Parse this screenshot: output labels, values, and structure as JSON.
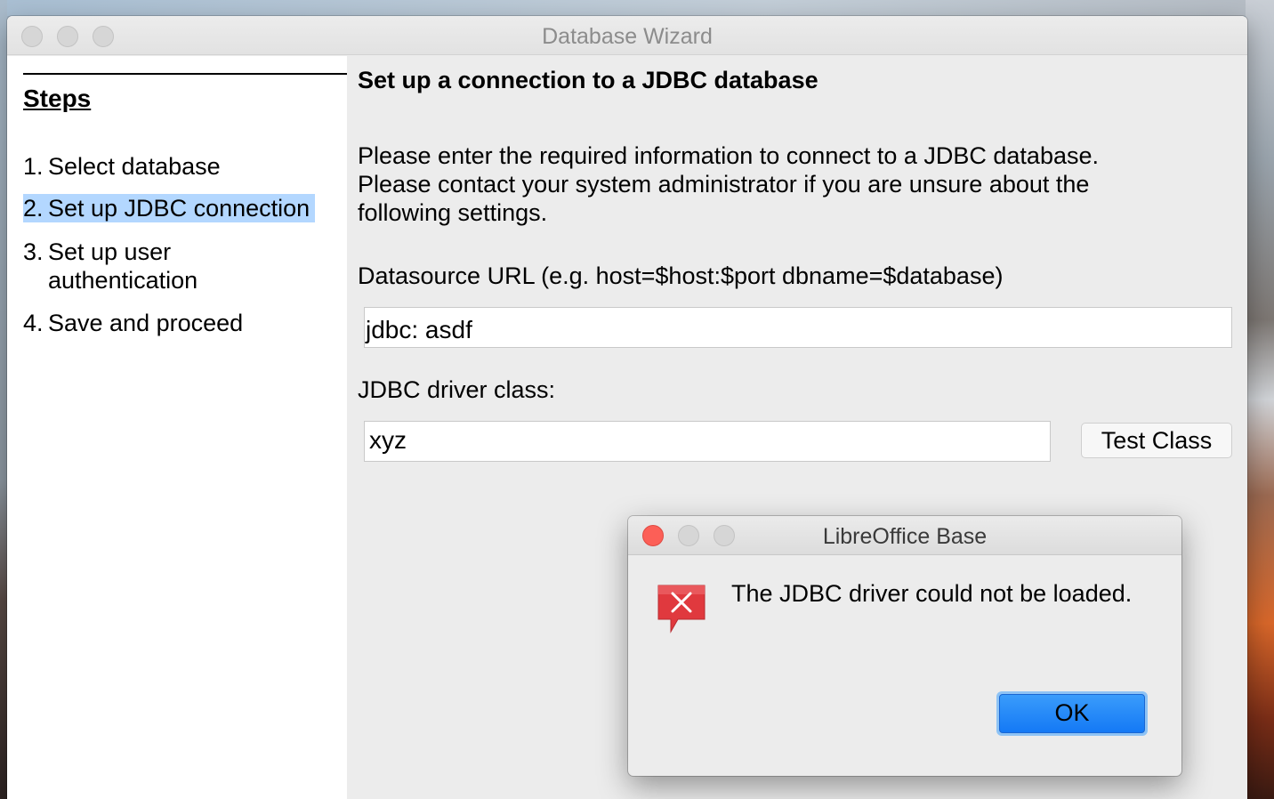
{
  "window": {
    "title": "Database Wizard"
  },
  "sidebar": {
    "heading": "Steps",
    "steps": [
      {
        "number": "1.",
        "label": "Select database",
        "selected": false
      },
      {
        "number": "2.",
        "label": "Set up JDBC connection",
        "selected": true
      },
      {
        "number": "3.",
        "label_line1": "Set up user",
        "label_line2": "authentication",
        "selected": false
      },
      {
        "number": "4.",
        "label": "Save and proceed",
        "selected": false
      }
    ]
  },
  "main": {
    "heading": "Set up a connection to a JDBC database",
    "description_line1": "Please enter the required information to connect to a JDBC database.",
    "description_line2": "Please contact your system administrator if you are unsure about the",
    "description_line3": "following settings.",
    "url_label": "Datasource URL (e.g. host=$host:$port dbname=$database)",
    "url_value": "jdbc: asdf",
    "driver_label": "JDBC driver class:",
    "driver_value": "xyz",
    "test_class_label": "Test Class"
  },
  "dialog": {
    "title": "LibreOffice Base",
    "message": "The JDBC driver could not be loaded.",
    "ok_label": "OK",
    "icon": "error-icon"
  },
  "colors": {
    "selection": "#b3d7ff",
    "ok_button": "#1479f5",
    "close_button": "#fc5f57",
    "error_icon": "#e0393e"
  }
}
